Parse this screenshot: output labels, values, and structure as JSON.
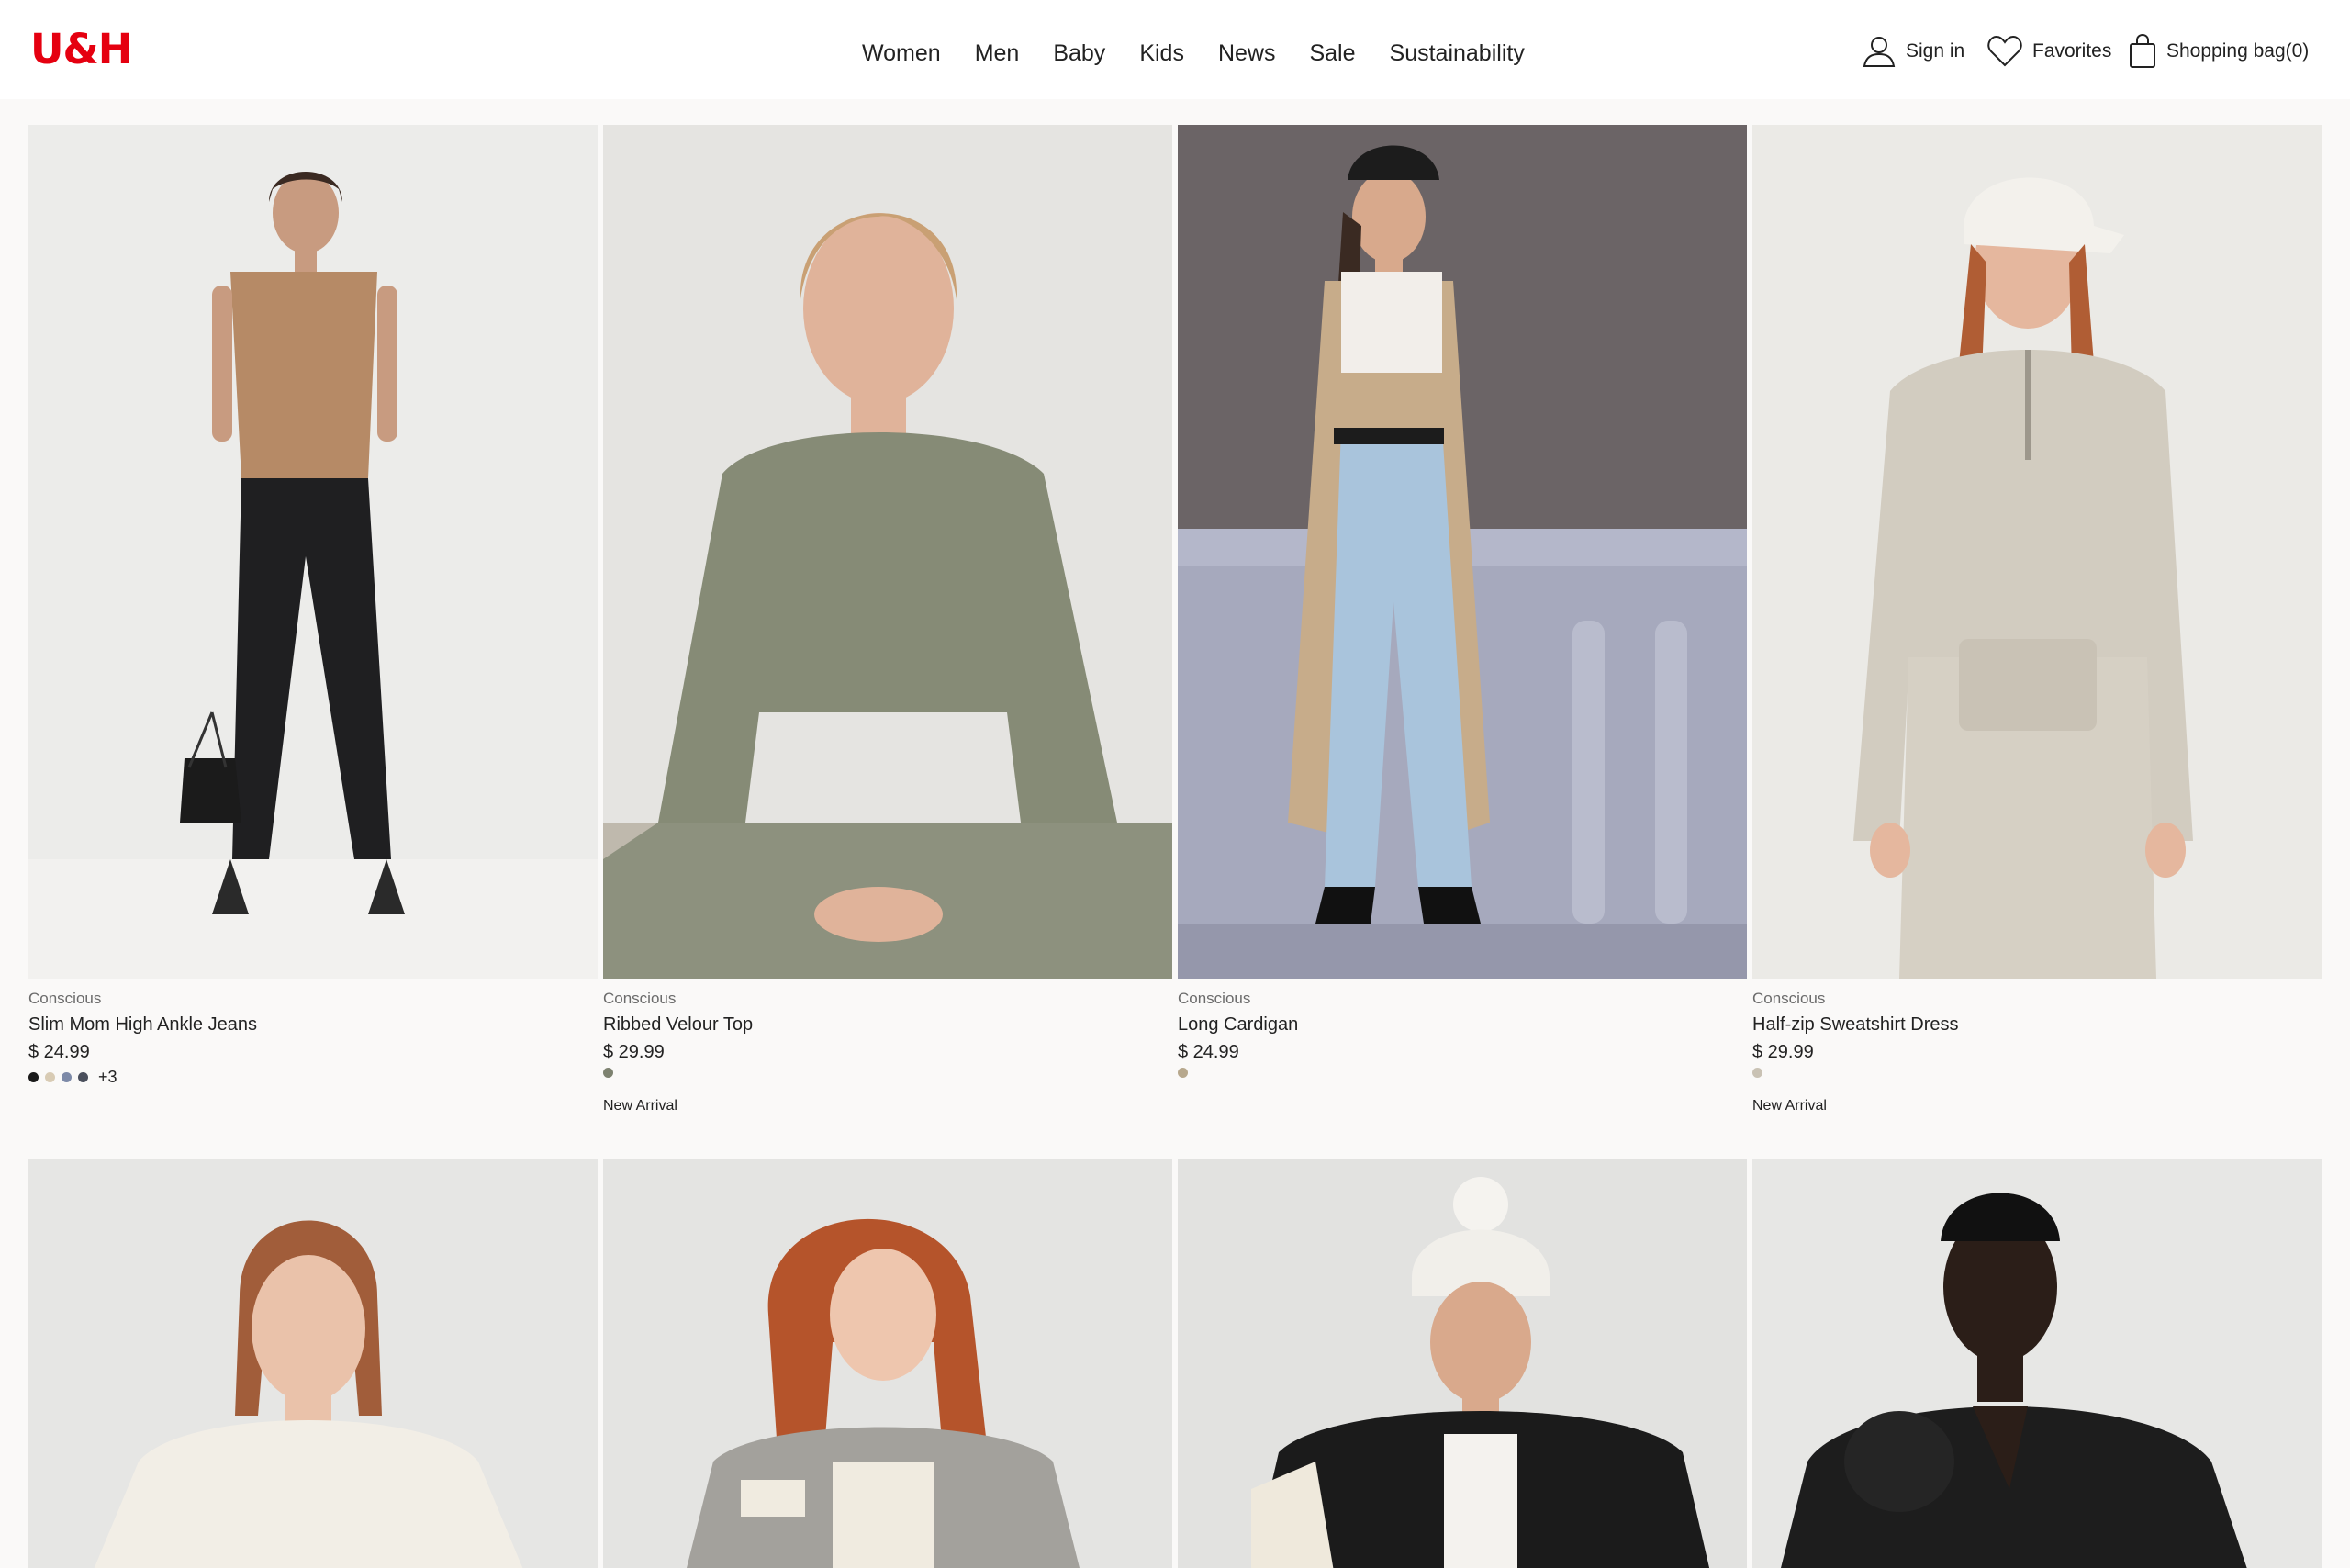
{
  "header": {
    "logo": "U&H",
    "nav": [
      "Women",
      "Men",
      "Baby",
      "Kids",
      "News",
      "Sale",
      "Sustainability"
    ],
    "sign_in": "Sign in",
    "favorites": "Favorites",
    "bag": "Shopping bag(0)"
  },
  "colors": {
    "brand": "#e50010",
    "background": "#faf9f8"
  },
  "products": [
    {
      "label": "Conscious",
      "name": "Slim Mom High Ankle Jeans",
      "price": "$ 24.99",
      "swatches": [
        "#1a1a1a",
        "#d8cbb4",
        "#7d8aa8",
        "#4a4f5c"
      ],
      "more": "+3",
      "badge": ""
    },
    {
      "label": "Conscious",
      "name": "Ribbed Velour Top",
      "price": "$ 29.99",
      "swatches": [
        "#7d8270"
      ],
      "more": "",
      "badge": "New Arrival"
    },
    {
      "label": "Conscious",
      "name": "Long Cardigan",
      "price": "$ 24.99",
      "swatches": [
        "#b7a88d"
      ],
      "more": "",
      "badge": ""
    },
    {
      "label": "Conscious",
      "name": "Half-zip Sweatshirt Dress",
      "price": "$ 29.99",
      "swatches": [
        "#c9c2b4"
      ],
      "more": "",
      "badge": "New Arrival"
    }
  ]
}
